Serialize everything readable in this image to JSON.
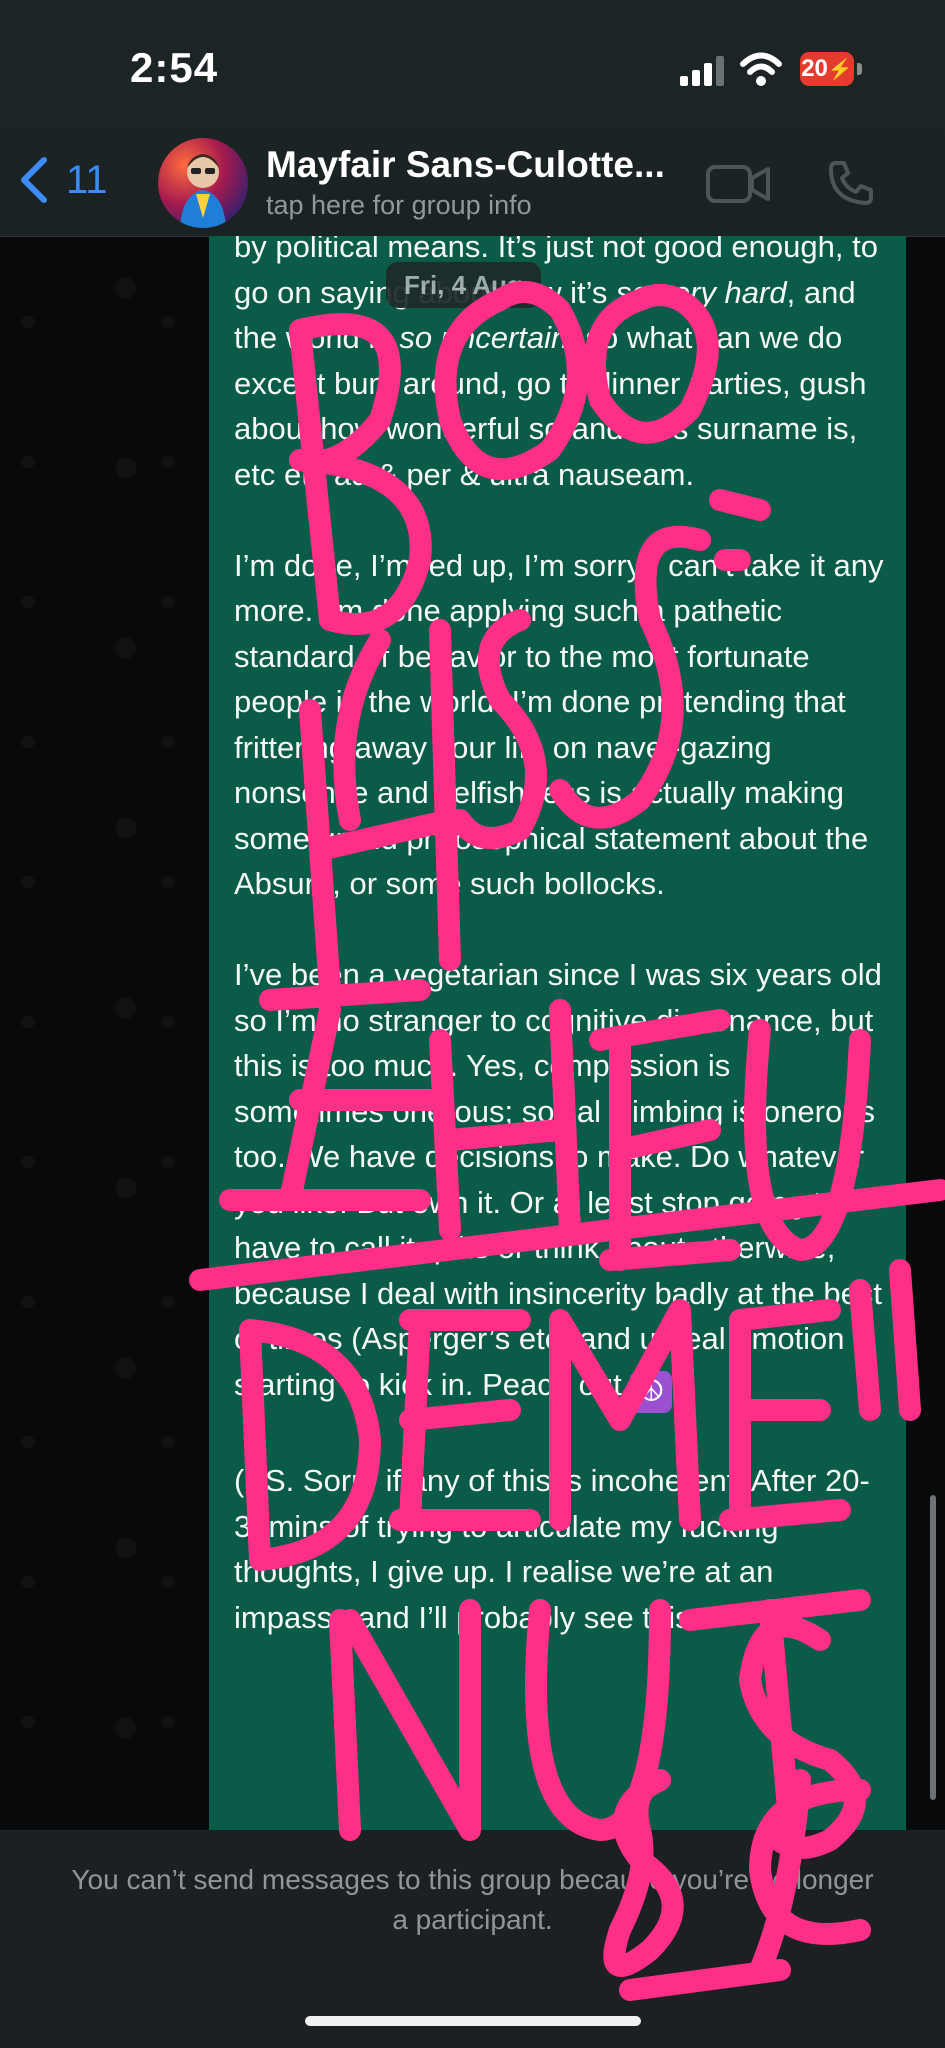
{
  "status": {
    "time": "2:54",
    "battery": "20"
  },
  "header": {
    "back_count": "11",
    "group_name": "Mayfair Sans-Culotte...",
    "subtitle": "tap here for group info"
  },
  "date_chip": "Fri, 4 Aug",
  "message": {
    "p1_a": "by political means. It’s just not good enough, to go on saying about how it’s ",
    "p1_em1": "so very hard",
    "p1_b": ", and the world is ",
    "p1_em2": "so uncertain",
    "p1_c": ", so what can we do except bum around, go to dinner parties, gush about how wonderful so-and-so’s surname is, etc etc ad & per & ultra nauseam.",
    "p2": "I’m done, I’m fed up, I’m sorry I can’t take it any more. I’m done applying such a pathetic standard of behavior to the most fortunate people in the world. I’m done pretending that frittering away your life on navel-gazing nonsense and selfishness is actually making some grand philosophical statement about the Absurd, or some such bollocks.",
    "p3": "I’ve been a vegetarian since I was six years old so I’m no stranger to cognitive dissonance, but this is too much. Yes, compassion is sometimes onerous; social climbing is onerous too. We have decisions to make. Do whatever you like. But own it. Or at least stop going to have to call it quits or think about otherwise, because I deal with insincerity badly at the best of times (Asperger’s etc) and unreal emotion is starting to kick in. Peace out",
    "p4": "(PS. Sorry if any of this is incoherent. After 20-30mins of trying to articulate my fucking thoughts, I give up. I realise we’re at an impasse and I’ll probably see this"
  },
  "footer": {
    "notice": "You can’t send messages to this group because you’re no longer a participant."
  },
  "annotation": {
    "color": "#ff2f87",
    "text": "BOO HISS! EHEU DEMERIT! NUTS 8C"
  },
  "colors": {
    "bubble": "#0a5b48",
    "accent": "#3b8cf5",
    "battery": "#e33b2e"
  }
}
